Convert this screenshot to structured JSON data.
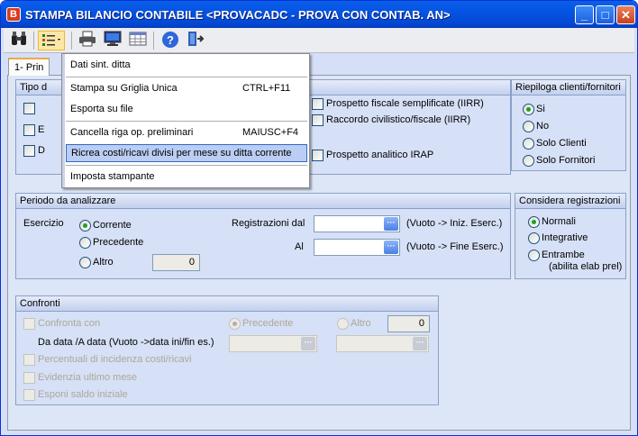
{
  "window": {
    "title": "STAMPA BILANCIO CONTABILE <PROVACADC - PROVA CON CONTAB. AN>",
    "app_icon": "B"
  },
  "toolbar": {
    "icons": [
      "binoculars-icon",
      "list-settings-icon",
      "printer-icon",
      "monitor-icon",
      "grid-icon",
      "help-icon",
      "exit-door-icon"
    ]
  },
  "tab": {
    "label": "1- Prin"
  },
  "menu": {
    "items": [
      {
        "label": "Dati sint. ditta",
        "shortcut": ""
      },
      {
        "label": "Stampa su Griglia Unica",
        "shortcut": "CTRL+F11"
      },
      {
        "label": "Esporta su file",
        "shortcut": ""
      },
      {
        "label": "Cancella riga op. preliminari",
        "shortcut": "MAIUSC+F4"
      },
      {
        "label": "Ricrea costi/ricavi divisi per mese su ditta corrente",
        "shortcut": ""
      },
      {
        "label": "Imposta stampante",
        "shortcut": ""
      }
    ]
  },
  "tipo": {
    "title": "Tipo d",
    "left_labels": [
      "",
      "E",
      "D"
    ],
    "options": [
      "Prospetto fiscale semplificate (IIRR)",
      "Raccordo civilistico/fiscale (IIRR)",
      "Prospetto analitico IRAP"
    ]
  },
  "riepiloga": {
    "title": "Riepiloga clienti/fornitori",
    "options": [
      "Si",
      "No",
      "Solo Clienti",
      "Solo Fornitori"
    ],
    "selected": "Si"
  },
  "periodo": {
    "title": "Periodo da analizzare",
    "esercizio_label": "Esercizio",
    "options": [
      "Corrente",
      "Precedente",
      "Altro"
    ],
    "selected": "Corrente",
    "altro_value": "0",
    "reg_dal_label": "Registrazioni dal",
    "al_label": "Al",
    "reg_dal_value": "",
    "al_value": "",
    "hint_dal": "(Vuoto -> Iniz. Eserc.)",
    "hint_al": "(Vuoto -> Fine Eserc.)"
  },
  "considera": {
    "title": "Considera registrazioni",
    "options": [
      "Normali",
      "Integrative",
      "Entrambe"
    ],
    "entrambe_sub": "(abilita elab prel)",
    "selected": "Normali"
  },
  "confronti": {
    "title": "Confronti",
    "confronta_label": "Confronta con",
    "precedente_label": "Precedente",
    "altro_label": "Altro",
    "altro_value": "0",
    "dates_label": "Da data /A data (Vuoto ->data ini/fin es.)",
    "checks": [
      "Percentuali di incidenza costi/ricavi",
      "Evidenzia ultimo mese",
      "Esponi saldo iniziale"
    ]
  }
}
